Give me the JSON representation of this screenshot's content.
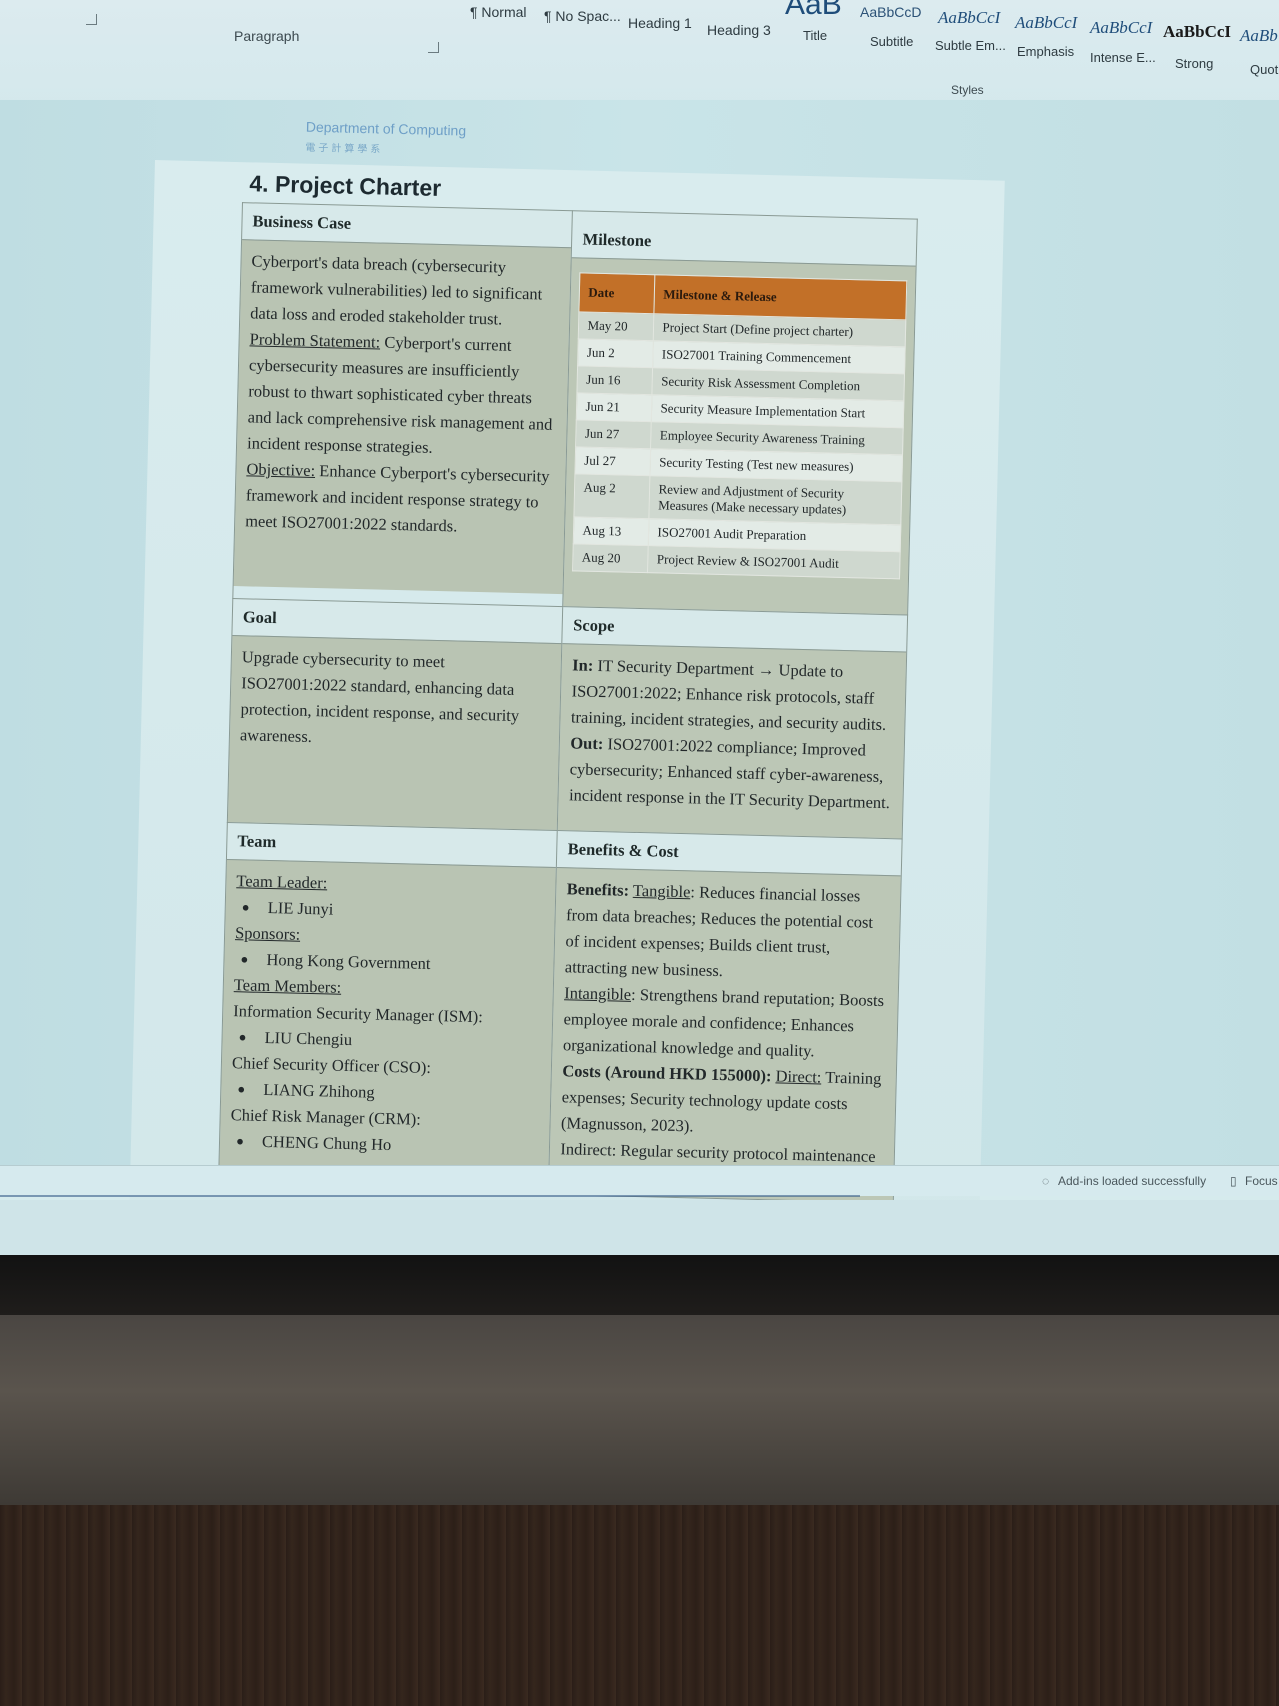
{
  "ribbon": {
    "paragraph_label": "Paragraph",
    "styles_label": "Styles",
    "styles": [
      {
        "sample": "¶ Normal",
        "name": ""
      },
      {
        "sample": "¶ No Spac...",
        "name": ""
      },
      {
        "sample": "",
        "name": "Heading 1"
      },
      {
        "sample": "",
        "name": "Heading 3"
      },
      {
        "sample": "AaB",
        "name": "Title"
      },
      {
        "sample": "AaBbCcD",
        "name": "Subtitle"
      },
      {
        "sample": "AaBbCcI",
        "name": "Subtle Em..."
      },
      {
        "sample": "AaBbCcI",
        "name": "Emphasis"
      },
      {
        "sample": "AaBbCcI",
        "name": "Intense E..."
      },
      {
        "sample": "AaBbCcI",
        "name": "Strong"
      },
      {
        "sample": "AaBb",
        "name": "Quot"
      }
    ]
  },
  "document": {
    "header_text": "Department of Computing",
    "header_sub": "電子計算學系",
    "section_title": "4. Project Charter",
    "business_case": {
      "heading": "Business Case",
      "intro": "Cyberport's data breach (cybersecurity framework vulnerabilities) led to significant data loss and eroded stakeholder trust.",
      "problem_label": "Problem Statement:",
      "problem_text": " Cyberport's current cybersecurity measures are insufficiently robust to thwart sophisticated cyber threats and lack comprehensive risk management and incident response strategies.",
      "objective_label": "Objective:",
      "objective_text": " Enhance Cyberport's cybersecurity framework and incident response strategy to meet ISO27001:2022 standards."
    },
    "milestone": {
      "heading": "Milestone",
      "col_date": "Date",
      "col_release": "Milestone & Release",
      "rows": [
        {
          "date": "May 20",
          "item": "Project Start (Define project charter)"
        },
        {
          "date": "Jun 2",
          "item": "ISO27001 Training Commencement"
        },
        {
          "date": "Jun 16",
          "item": "Security Risk Assessment Completion"
        },
        {
          "date": "Jun 21",
          "item": "Security Measure Implementation Start"
        },
        {
          "date": "Jun 27",
          "item": "Employee Security Awareness Training"
        },
        {
          "date": "Jul 27",
          "item": "Security Testing (Test new measures)"
        },
        {
          "date": "Aug 2",
          "item": "Review and Adjustment of Security Measures (Make necessary updates)"
        },
        {
          "date": "Aug 13",
          "item": "ISO27001 Audit Preparation"
        },
        {
          "date": "Aug 20",
          "item": "Project Review & ISO27001 Audit"
        }
      ]
    },
    "goal": {
      "heading": "Goal",
      "text": "Upgrade cybersecurity to meet ISO27001:2022 standard, enhancing data protection, incident response, and security awareness."
    },
    "scope": {
      "heading": "Scope",
      "in_label": "In:",
      "in_text": " IT Security Department → Update to ISO27001:2022; Enhance risk protocols, staff training, incident strategies, and security audits.",
      "out_label": "Out:",
      "out_text": " ISO27001:2022 compliance; Improved cybersecurity; Enhanced staff cyber-awareness, incident response in the IT Security Department."
    },
    "team": {
      "heading": "Team",
      "leader_label": "Team Leader:",
      "leader": "LIE Junyi",
      "sponsors_label": "Sponsors:",
      "sponsor": "Hong Kong Government",
      "members_label": "Team Members:",
      "ism_role": "Information Security Manager (ISM):",
      "ism": "LIU Chengiu",
      "cso_role": "Chief Security Officer (CSO):",
      "cso": "LIANG Zhihong",
      "crm_role": "Chief Risk Manager (CRM):",
      "crm": "CHENG Chung Ho"
    },
    "benefits": {
      "heading": "Benefits & Cost",
      "benefits_label": "Benefits:",
      "tangible_label": "Tangible",
      "tangible_text": ": Reduces financial losses from data breaches; Reduces the potential cost of incident expenses; Builds client trust, attracting new business.",
      "intangible_label": "Intangible",
      "intangible_text": ": Strengthens brand reputation; Boosts employee morale and confidence; Enhances organizational knowledge and quality.",
      "costs_label": "Costs (Around HKD 155000):",
      "direct_label": "Direct:",
      "direct_text": " Training expenses; Security technology update costs (Magnusson, 2023).",
      "indirect_text": "Indirect: Regular security protocol maintenance"
    }
  },
  "status_bar": {
    "addins": "Add-ins loaded successfully",
    "focus": "Focus"
  }
}
